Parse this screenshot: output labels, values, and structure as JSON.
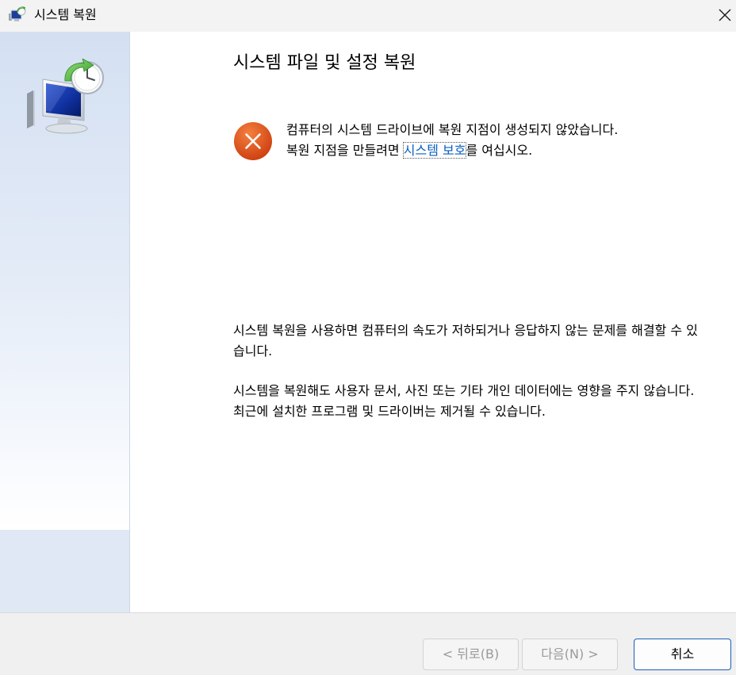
{
  "window": {
    "title": "시스템 복원",
    "icons": {
      "app": "system-restore-icon",
      "close": "close-icon",
      "hero": "system-restore-monitor-clock-icon",
      "error": "error-icon"
    }
  },
  "main": {
    "heading": "시스템 파일 및 설정 복원",
    "error": {
      "line1": "컴퓨터의 시스템 드라이브에 복원 지점이 생성되지 않았습니다.",
      "line2_before": "복원 지점을 만들려면 ",
      "link": "시스템 보호",
      "line2_after": "를 여십시오."
    },
    "paragraph1": "시스템 복원을 사용하면 컴퓨터의 속도가 저하되거나 응답하지 않는 문제를 해결할 수 있습니다.",
    "paragraph2": "시스템을 복원해도 사용자 문서, 사진 또는 기타 개인 데이터에는 영향을 주지 않습니다. 최근에 설치한 프로그램 및 드라이버는 제거될 수 있습니다."
  },
  "footer": {
    "back_label": "< 뒤로(B)",
    "next_label": "다음(N) >",
    "cancel_label": "취소"
  },
  "colors": {
    "sidebar": "#d4e0f2",
    "link": "#0a5fc2",
    "error": "#d83b01",
    "accent_border": "#1a5fb4"
  }
}
